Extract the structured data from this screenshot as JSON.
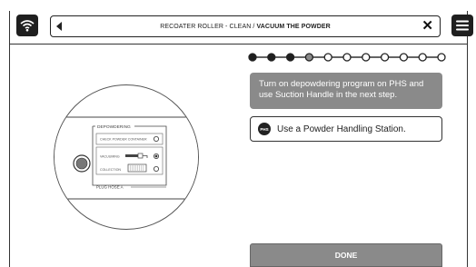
{
  "header": {
    "title_prefix": "RECOATER ROLLER - CLEAN / ",
    "title_bold": "VACUUM THE POWDER"
  },
  "progress": {
    "total_steps": 11,
    "completed_steps": 3,
    "current_step": 4
  },
  "instruction": {
    "text": "Turn on depowdering program on PHS and use Suction Handle in the next step."
  },
  "tip": {
    "badge": "PHS",
    "text": "Use a Powder Handling Station."
  },
  "illustration": {
    "group_label": "DEPOWDERING",
    "rows": [
      {
        "label": "CHECK POWDER CONTAINER"
      },
      {
        "label": "VACUUMING"
      },
      {
        "label": "COLLECTION"
      }
    ],
    "footer_label": "PLUG HOSE A"
  },
  "actions": {
    "done_label": "DONE"
  },
  "colors": {
    "dark": "#1f1f1f",
    "gray_panel": "#8a8a8a",
    "current_step": "#8a8a8a"
  }
}
